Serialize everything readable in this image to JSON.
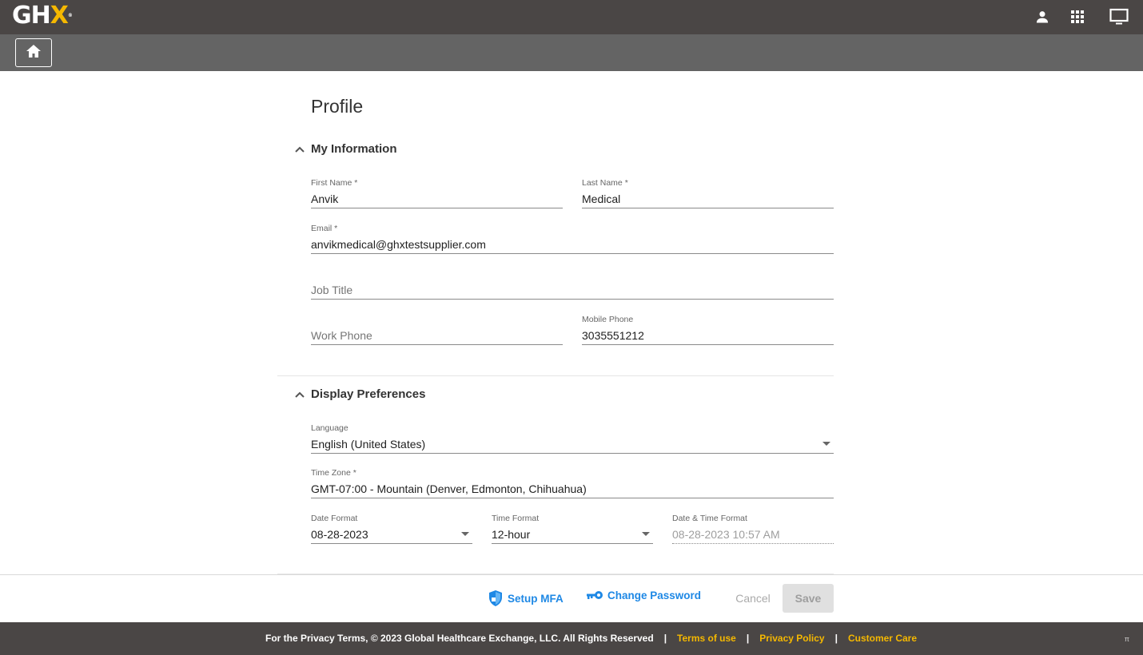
{
  "header": {
    "logo_text": "GH",
    "logo_x": "X",
    "logo_tm": "®",
    "icons": [
      "user-icon",
      "apps-grid-icon",
      "monitor-icon"
    ]
  },
  "page": {
    "title": "Profile"
  },
  "my_information": {
    "title": "My Information",
    "first_name": {
      "label": "First Name *",
      "value": "Anvik"
    },
    "last_name": {
      "label": "Last Name *",
      "value": "Medical"
    },
    "email": {
      "label": "Email *",
      "value": "anvikmedical@ghxtestsupplier.com"
    },
    "job_title": {
      "placeholder": "Job Title"
    },
    "work_phone": {
      "placeholder": "Work Phone"
    },
    "mobile_phone": {
      "label": "Mobile Phone",
      "value": "3035551212"
    }
  },
  "display_preferences": {
    "title": "Display Preferences",
    "language": {
      "label": "Language",
      "value": "English (United States)"
    },
    "time_zone": {
      "label": "Time Zone *",
      "value": "GMT-07:00 - Mountain (Denver, Edmonton, Chihuahua)"
    },
    "date_format": {
      "label": "Date Format",
      "value": "08-28-2023"
    },
    "time_format": {
      "label": "Time Format",
      "value": "12-hour"
    },
    "date_time_format": {
      "label": "Date & Time Format",
      "value": "08-28-2023 10:57 AM"
    }
  },
  "actions": {
    "setup_mfa": "Setup MFA",
    "change_password": "Change Password",
    "cancel": "Cancel",
    "save": "Save"
  },
  "footer": {
    "copyright": "For the Privacy Terms, © 2023 Global Healthcare Exchange, LLC. All Rights Reserved",
    "separator": "|",
    "terms": "Terms of use",
    "privacy": "Privacy Policy",
    "care": "Customer Care",
    "pi": "π"
  },
  "colors": {
    "topbar": "#4a4645",
    "subbar": "#646464",
    "accent_link": "#1e88e5",
    "footer_link": "#f5b800"
  }
}
